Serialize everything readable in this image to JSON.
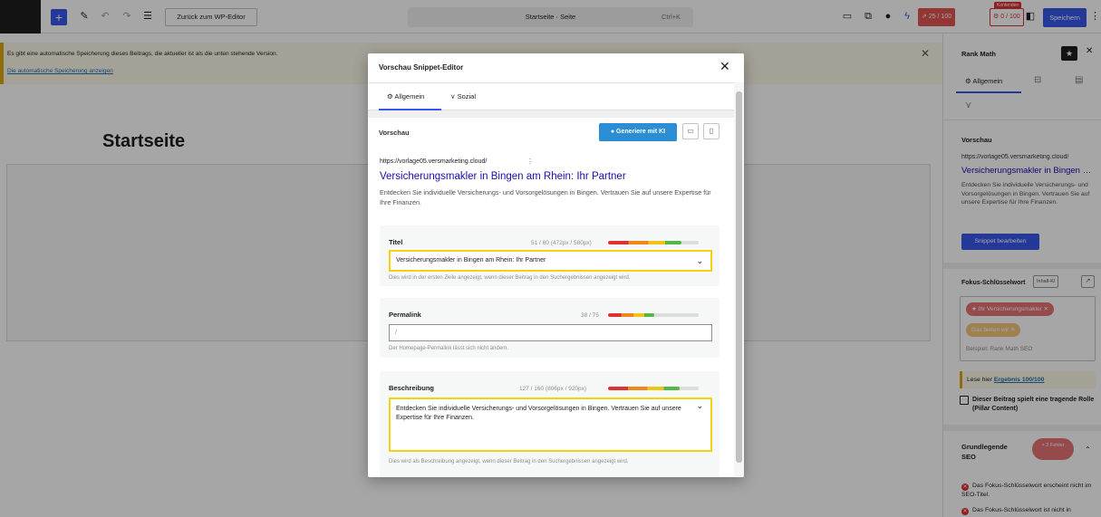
{
  "toolbar": {
    "back_label": "Zurück zum WP-Editor",
    "doc_title": "Startseite · Seite",
    "shortcut": "Ctrl+K",
    "score_red": "25 / 100",
    "score_outline": "0 / 100",
    "ki_tag": "Kontenden",
    "save_label": "Speichern"
  },
  "notice": {
    "text": "Es gibt eine automatische Speicherung dieses Beitrags, die aktueller ist als die unten stehende Version.",
    "link": "Die automatische Speicherung anzeigen"
  },
  "editor": {
    "page_title": "Startseite"
  },
  "sidebar": {
    "title": "Rank Math",
    "tab_general": "Allgemein",
    "preview_title": "Vorschau",
    "url": "https://vorlage05.versmarketing.cloud/",
    "link": "Versicherungsmakler in Bingen am Rhein: Ihr Partner",
    "desc": "Entdecken Sie individuelle Versicherungs- und Vorsorgelösungen in Bingen. Vertrauen Sie auf unsere Expertise für Ihre Finanzen.",
    "snippet_button": "Snippet bearbeiten",
    "focus_label": "Fokus-Schlüsselwort",
    "inhalt_ki": "Inhalt-KI",
    "kw1": "Ihr Versicherungsmakler",
    "kw2": "Das bieten wir",
    "kw_example": "Beispiel: Rank Math SEO",
    "result_prefix": "Lese hier ",
    "result_link": "Ergebnis 100/100",
    "pillar": "Dieser Beitrag spielt eine tragende Rolle (Pillar Content)",
    "grund": "Grundlegende SEO",
    "fehler": "× 2 Fehler",
    "err1": "Das Fokus-Schlüsselwort erscheint nicht im SEO-Titel.",
    "err2": "Das Fokus-Schlüsselwort ist nicht in"
  },
  "modal": {
    "title": "Vorschau Snippet-Editor",
    "tab_general": "Allgemein",
    "tab_social": "Sozial",
    "preview_label": "Vorschau",
    "ki_button": "Generiere mit KI",
    "url": "https://vorlage05.versmarketing.cloud/",
    "link": "Versicherungsmakler in Bingen am Rhein: Ihr Partner",
    "desc": "Entdecken Sie individuelle Versicherungs- und Vorsorgelösungen in Bingen. Vertrauen Sie auf unsere Expertise für Ihre Finanzen.",
    "title_field": {
      "label": "Titel",
      "count": "51 / 60 (472px / 580px)",
      "value": "Versicherungsmakler in Bingen am Rhein: Ihr Partner",
      "help": "Dies wird in der ersten Zeile angezeigt, wenn dieser Beitrag in den Suchergebnissen angezeigt wird.",
      "fill": 0.81
    },
    "permalink_field": {
      "label": "Permalink",
      "count": "38 / 75",
      "value": "/",
      "help": "Der Homepage-Permalink lässt sich nicht ändern.",
      "fill": 0.51
    },
    "desc_field": {
      "label": "Beschreibung",
      "count": "127 / 160 (806px / 920px)",
      "value": "Entdecken Sie individuelle Versicherungs- und Vorsorgelösungen in Bingen. Vertrauen Sie auf unsere Expertise für Ihre Finanzen.",
      "help": "Dies wird als Beschreibung angezeigt, wenn dieser Beitrag in den Suchergebnissen angezeigt wird.",
      "fill": 0.79
    }
  },
  "colors": {
    "accent": "#3858e9",
    "highlight": "#f2d314",
    "link": "#1a0dab",
    "error": "#dc3232"
  }
}
